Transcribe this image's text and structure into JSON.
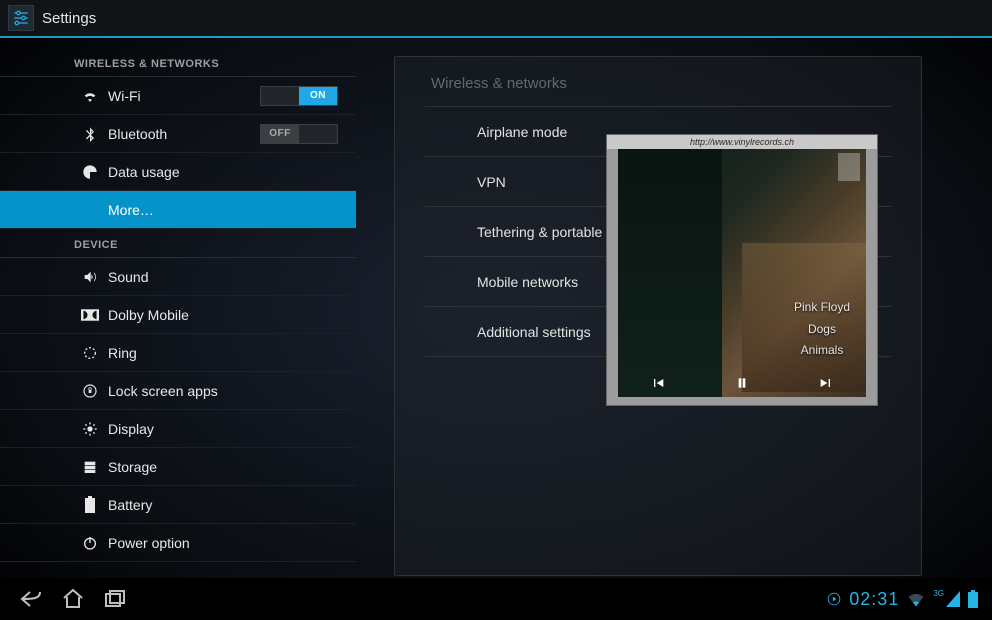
{
  "actionbar": {
    "title": "Settings"
  },
  "sections": {
    "wireless_header": "WIRELESS & NETWORKS",
    "device_header": "DEVICE"
  },
  "nav": {
    "wifi": {
      "label": "Wi-Fi",
      "toggle": "ON"
    },
    "bluetooth": {
      "label": "Bluetooth",
      "toggle": "OFF"
    },
    "data_usage": {
      "label": "Data usage"
    },
    "more": {
      "label": "More…"
    },
    "sound": {
      "label": "Sound"
    },
    "dolby": {
      "label": "Dolby Mobile"
    },
    "ring": {
      "label": "Ring"
    },
    "lock_apps": {
      "label": "Lock screen apps"
    },
    "display": {
      "label": "Display"
    },
    "storage": {
      "label": "Storage"
    },
    "battery": {
      "label": "Battery"
    },
    "power": {
      "label": "Power option"
    }
  },
  "detail": {
    "header": "Wireless & networks",
    "airplane": "Airplane mode",
    "vpn": "VPN",
    "tethering": "Tethering & portable hotsp",
    "mobile": "Mobile networks",
    "additional": "Additional settings"
  },
  "music": {
    "url": "http://www.vinylrecords.ch",
    "artist": "Pink Floyd",
    "track": "Dogs",
    "album": "Animals"
  },
  "sysbar": {
    "clock": "02:31",
    "network_label": "3G"
  },
  "toggle_labels": {
    "on": "ON",
    "off": "OFF"
  }
}
